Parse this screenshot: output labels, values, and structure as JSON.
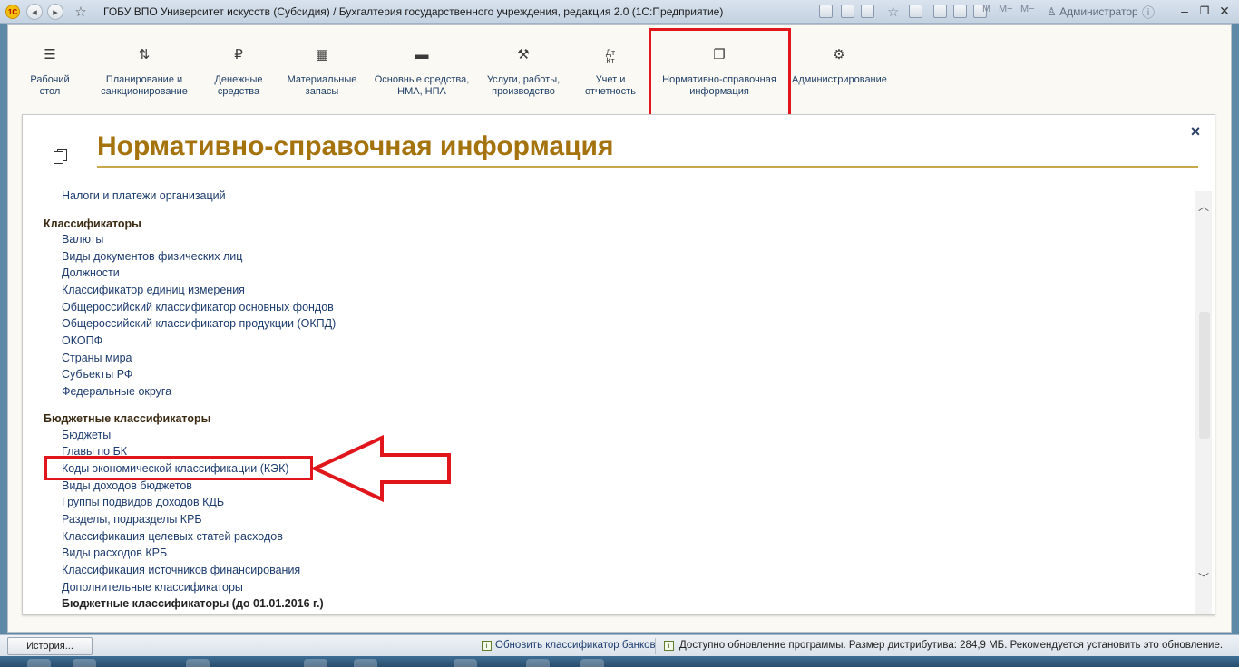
{
  "window": {
    "title": "ГОБУ ВПО Университет искусств (Субсидия) / Бухгалтерия государственного учреждения, редакция 2.0  (1С:Предприятие)",
    "logo": "1С",
    "toolbar_right": {
      "m": "M",
      "m_plus": "M+",
      "m_minus": "M−",
      "user": "Администратор"
    }
  },
  "sections": [
    {
      "label": "Рабочий стол",
      "icon": "hamburger-menu-icon"
    },
    {
      "label": "Планирование и санкционирование",
      "icon": "planning-icon"
    },
    {
      "label": "Денежные средства",
      "icon": "ruble-icon"
    },
    {
      "label": "Материальные запасы",
      "icon": "grid-icon"
    },
    {
      "label": "Основные средства, НМА, НПА",
      "icon": "truck-icon"
    },
    {
      "label": "Услуги, работы, производство",
      "icon": "tools-icon"
    },
    {
      "label": "Учет и отчетность",
      "icon": "debit-credit-icon"
    },
    {
      "label": "Нормативно-справочная информация",
      "icon": "reference-books-icon"
    },
    {
      "label": "Администрирование",
      "icon": "gear-icon"
    }
  ],
  "content": {
    "title": "Нормативно-справочная информация",
    "top_item": "Налоги и платежи организаций",
    "groups": [
      {
        "label": "Классификаторы",
        "items": [
          "Валюты",
          "Виды документов физических лиц",
          "Должности",
          "Классификатор единиц измерения",
          "Общероссийский классификатор основных фондов",
          "Общероссийский классификатор продукции (ОКПД)",
          "ОКОПФ",
          "Страны мира",
          "Субъекты РФ",
          "Федеральные округа"
        ]
      },
      {
        "label": "Бюджетные классификаторы",
        "items": [
          "Бюджеты",
          "Главы по БК",
          "Коды экономической классификации (КЭК)",
          "Виды доходов бюджетов",
          "Группы подвидов доходов КДБ",
          "Разделы, подразделы КРБ",
          "Классификация целевых статей расходов",
          "Виды расходов КРБ",
          "Классификация источников финансирования",
          "Дополнительные классификаторы"
        ]
      },
      {
        "label": "Бюджетные классификаторы (до 01.01.2016 г.)",
        "items": []
      }
    ]
  },
  "statusbar": {
    "history_button": "История...",
    "update_link": "Обновить классификатор банков",
    "update_message": "Доступно обновление программы. Размер дистрибутива: 284,9 МБ. Рекомендуется установить это обновление."
  },
  "annotation_color": "#e0161c",
  "accent_title_color": "#a4730d"
}
